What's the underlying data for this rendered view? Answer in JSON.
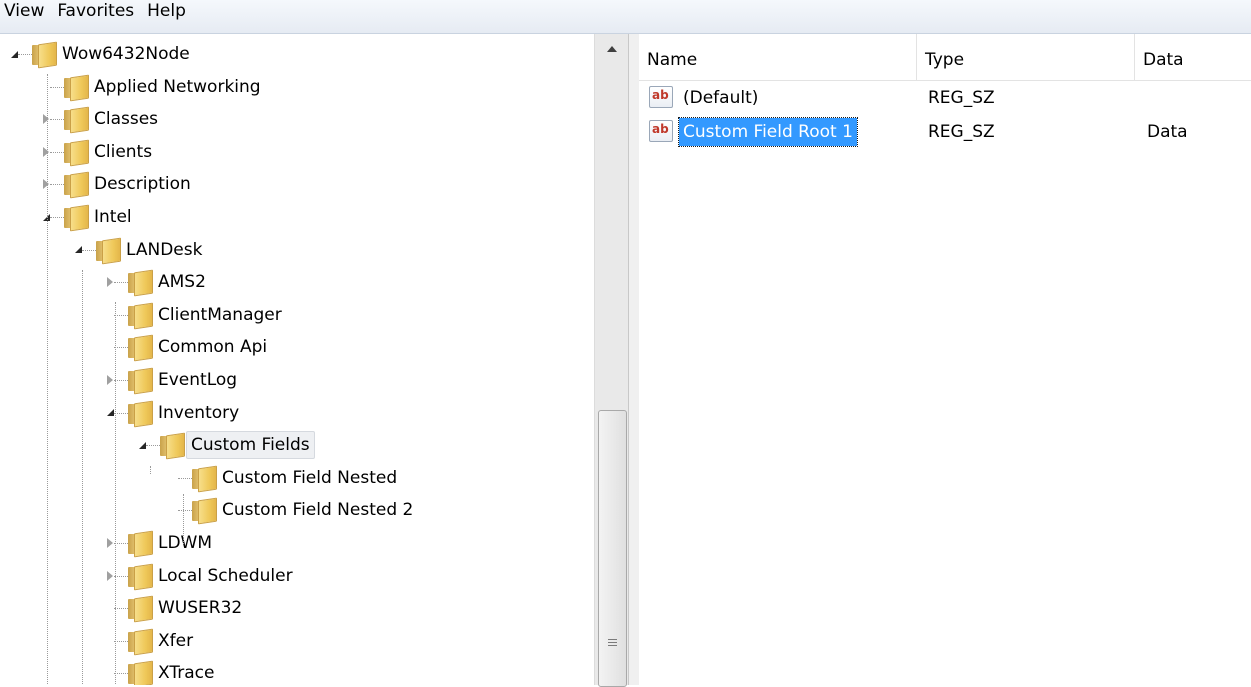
{
  "menu": [
    "View",
    "Favorites",
    "Help"
  ],
  "tree": [
    {
      "label": "Wow6432Node",
      "expander": "expanded"
    },
    {
      "label": "Applied Networking",
      "expander": "none"
    },
    {
      "label": "Classes",
      "expander": "collapsed"
    },
    {
      "label": "Clients",
      "expander": "collapsed"
    },
    {
      "label": "Description",
      "expander": "collapsed"
    },
    {
      "label": "Intel",
      "expander": "expanded"
    },
    {
      "label": "LANDesk",
      "expander": "expanded"
    },
    {
      "label": "AMS2",
      "expander": "collapsed"
    },
    {
      "label": "ClientManager",
      "expander": "none"
    },
    {
      "label": "Common Api",
      "expander": "none"
    },
    {
      "label": "EventLog",
      "expander": "collapsed"
    },
    {
      "label": "Inventory",
      "expander": "expanded"
    },
    {
      "label": "Custom Fields",
      "expander": "expanded",
      "selected": true
    },
    {
      "label": "Custom Field Nested",
      "expander": "none"
    },
    {
      "label": "Custom Field Nested 2",
      "expander": "none"
    },
    {
      "label": "LDWM",
      "expander": "collapsed"
    },
    {
      "label": "Local Scheduler",
      "expander": "collapsed"
    },
    {
      "label": "WUSER32",
      "expander": "none"
    },
    {
      "label": "Xfer",
      "expander": "none"
    },
    {
      "label": "XTrace",
      "expander": "none"
    }
  ],
  "list": {
    "columns": [
      "Name",
      "Type",
      "Data"
    ],
    "rows": [
      {
        "icon": "ab",
        "name": "(Default)",
        "type": "REG_SZ",
        "data": ""
      },
      {
        "icon": "ab",
        "name": "Custom Field Root 1",
        "type": "REG_SZ",
        "data": "Data",
        "selected": true
      }
    ]
  }
}
